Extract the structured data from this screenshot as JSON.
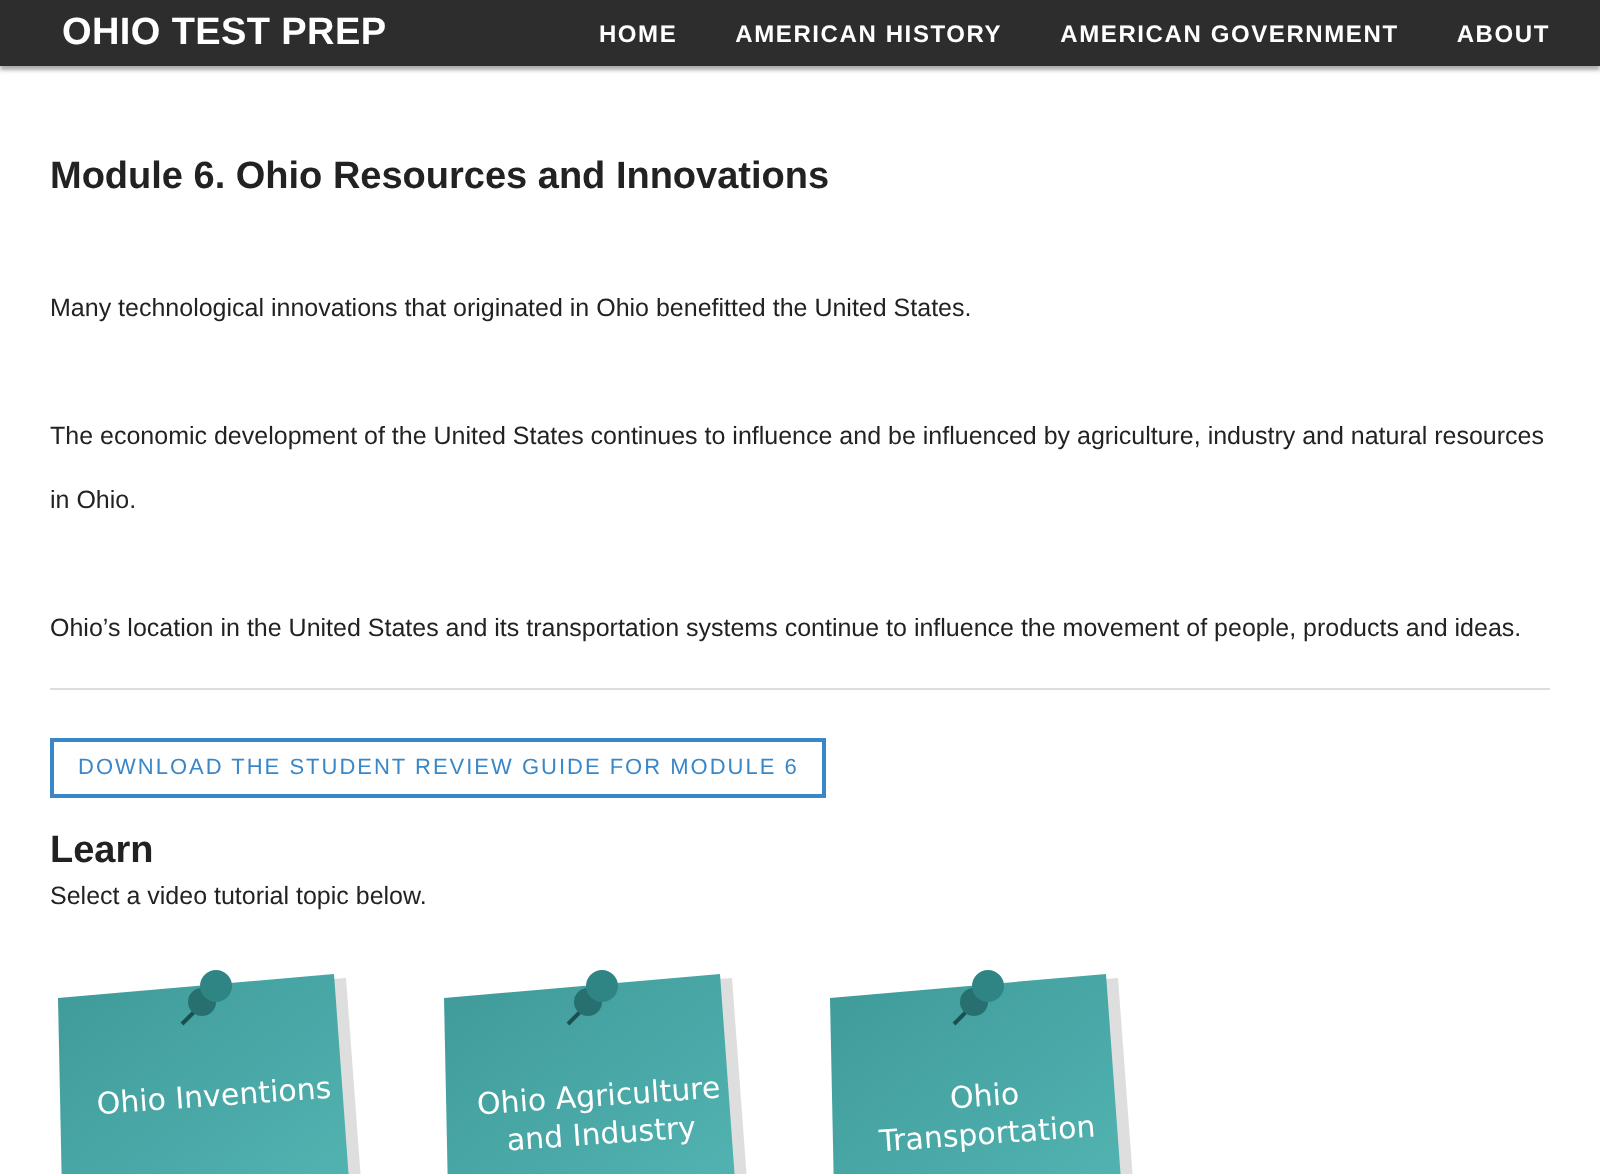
{
  "header": {
    "logo": "OHIO TEST PREP",
    "nav": [
      {
        "label": "HOME"
      },
      {
        "label": "AMERICAN HISTORY"
      },
      {
        "label": "AMERICAN GOVERNMENT"
      },
      {
        "label": "ABOUT"
      }
    ]
  },
  "title": "Module 6. Ohio Resources and Innovations",
  "paragraphs": [
    "Many technological innovations that originated in Ohio benefitted the United States.",
    "The economic development of the United States continues to influence and be influenced by agriculture, industry and natural resources in Ohio.",
    "Ohio’s location in the United States and its transportation systems continue to influence the movement of people, products and ideas."
  ],
  "download_button": "DOWNLOAD THE STUDENT REVIEW GUIDE FOR MODULE 6",
  "learn": {
    "heading": "Learn",
    "subtitle": "Select a video tutorial topic below.",
    "topics": [
      {
        "lines": [
          "Ohio Inventions"
        ]
      },
      {
        "lines": [
          "Ohio Agriculture",
          "and Industry"
        ]
      },
      {
        "lines": [
          "Ohio",
          "Transportation"
        ]
      }
    ]
  }
}
